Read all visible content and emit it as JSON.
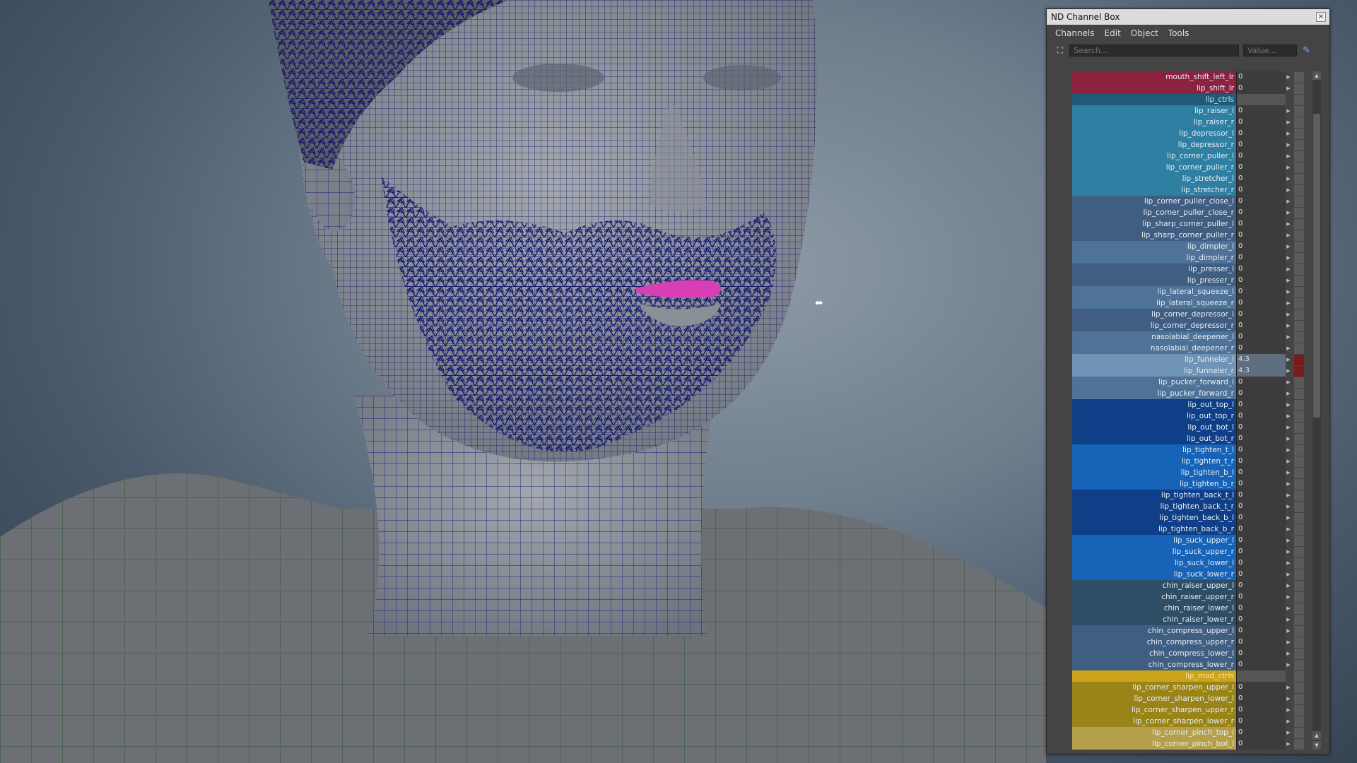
{
  "window": {
    "title": "ND Channel Box",
    "close_glyph": "×"
  },
  "menu": [
    "Channels",
    "Edit",
    "Object",
    "Tools"
  ],
  "search": {
    "placeholder": "Search...",
    "value_placeholder": "Value..."
  },
  "icons": {
    "select": "select-icon",
    "pencil": "pencil-icon",
    "scroll_up": "▲",
    "scroll_down": "▼"
  },
  "colors": {
    "crimson": "#8a2240",
    "teal_header": "#1f5a78",
    "teal": "#2f7fa3",
    "slate": "#3f5e82",
    "steel": "#4e7298",
    "funnel": "#6f94b6",
    "navy": "#0f3f86",
    "blue": "#1663b7",
    "dark_slate": "#2e4e66",
    "gold_header": "#caa41a",
    "olive": "#9a8418",
    "khaki": "#b4a04a"
  },
  "channels": [
    {
      "name": "mouth_shift_left_lr",
      "value": "0",
      "group": "crimson"
    },
    {
      "name": "lip_shift_lr",
      "value": "0",
      "group": "crimson"
    },
    {
      "name": "lip_ctrls",
      "value": "",
      "group": "teal_header",
      "header": true
    },
    {
      "name": "lip_raiser_l",
      "value": "0",
      "group": "teal"
    },
    {
      "name": "lip_raiser_r",
      "value": "0",
      "group": "teal"
    },
    {
      "name": "lip_depressor_l",
      "value": "0",
      "group": "teal"
    },
    {
      "name": "lip_depressor_r",
      "value": "0",
      "group": "teal"
    },
    {
      "name": "lip_corner_puller_l",
      "value": "0",
      "group": "teal"
    },
    {
      "name": "lip_corner_puller_r",
      "value": "0",
      "group": "teal"
    },
    {
      "name": "lip_stretcher_l",
      "value": "0",
      "group": "teal"
    },
    {
      "name": "lip_stretcher_r",
      "value": "0",
      "group": "teal"
    },
    {
      "name": "lip_corner_puller_close_l",
      "value": "0",
      "group": "slate"
    },
    {
      "name": "lip_corner_puller_close_r",
      "value": "0",
      "group": "slate"
    },
    {
      "name": "lip_sharp_corner_puller_l",
      "value": "0",
      "group": "slate"
    },
    {
      "name": "lip_sharp_corner_puller_r",
      "value": "0",
      "group": "slate"
    },
    {
      "name": "lip_dimpler_l",
      "value": "0",
      "group": "steel"
    },
    {
      "name": "lip_dimpler_r",
      "value": "0",
      "group": "steel"
    },
    {
      "name": "lip_presser_l",
      "value": "0",
      "group": "slate"
    },
    {
      "name": "lip_presser_r",
      "value": "0",
      "group": "slate"
    },
    {
      "name": "lip_lateral_squeeze_l",
      "value": "0",
      "group": "steel"
    },
    {
      "name": "lip_lateral_squeeze_r",
      "value": "0",
      "group": "steel"
    },
    {
      "name": "lip_corner_depressor_l",
      "value": "0",
      "group": "slate"
    },
    {
      "name": "lip_corner_depressor_r",
      "value": "0",
      "group": "slate"
    },
    {
      "name": "nasolabial_deepener_l",
      "value": "0",
      "group": "steel"
    },
    {
      "name": "nasolabial_deepener_r",
      "value": "0",
      "group": "steel"
    },
    {
      "name": "lip_funneler_l",
      "value": "4.3",
      "group": "funnel",
      "keyed": true
    },
    {
      "name": "lip_funneler_r",
      "value": "4.3",
      "group": "funnel",
      "keyed": true
    },
    {
      "name": "lip_pucker_forward_l",
      "value": "0",
      "group": "steel"
    },
    {
      "name": "lip_pucker_forward_r",
      "value": "0",
      "group": "steel"
    },
    {
      "name": "lip_out_top_l",
      "value": "0",
      "group": "navy"
    },
    {
      "name": "lip_out_top_r",
      "value": "0",
      "group": "navy"
    },
    {
      "name": "lip_out_bot_l",
      "value": "0",
      "group": "navy"
    },
    {
      "name": "lip_out_bot_r",
      "value": "0",
      "group": "navy"
    },
    {
      "name": "lip_tighten_t_l",
      "value": "0",
      "group": "blue"
    },
    {
      "name": "lip_tighten_t_r",
      "value": "0",
      "group": "blue"
    },
    {
      "name": "lip_tighten_b_l",
      "value": "0",
      "group": "blue"
    },
    {
      "name": "lip_tighten_b_r",
      "value": "0",
      "group": "blue"
    },
    {
      "name": "lip_tighten_back_t_l",
      "value": "0",
      "group": "navy"
    },
    {
      "name": "lip_tighten_back_t_r",
      "value": "0",
      "group": "navy"
    },
    {
      "name": "lip_tighten_back_b_l",
      "value": "0",
      "group": "navy"
    },
    {
      "name": "lip_tighten_back_b_r",
      "value": "0",
      "group": "navy"
    },
    {
      "name": "lip_suck_upper_l",
      "value": "0",
      "group": "blue"
    },
    {
      "name": "lip_suck_upper_r",
      "value": "0",
      "group": "blue"
    },
    {
      "name": "lip_suck_lower_l",
      "value": "0",
      "group": "blue"
    },
    {
      "name": "lip_suck_lower_r",
      "value": "0",
      "group": "blue"
    },
    {
      "name": "chin_raiser_upper_l",
      "value": "0",
      "group": "dark_slate"
    },
    {
      "name": "chin_raiser_upper_r",
      "value": "0",
      "group": "dark_slate"
    },
    {
      "name": "chin_raiser_lower_l",
      "value": "0",
      "group": "dark_slate"
    },
    {
      "name": "chin_raiser_lower_r",
      "value": "0",
      "group": "dark_slate"
    },
    {
      "name": "chin_compress_upper_l",
      "value": "0",
      "group": "slate"
    },
    {
      "name": "chin_compress_upper_r",
      "value": "0",
      "group": "slate"
    },
    {
      "name": "chin_compress_lower_l",
      "value": "0",
      "group": "slate"
    },
    {
      "name": "chin_compress_lower_r",
      "value": "0",
      "group": "slate"
    },
    {
      "name": "lip_mod_ctrls",
      "value": "",
      "group": "gold_header",
      "header": true
    },
    {
      "name": "lip_corner_sharpen_upper_l",
      "value": "0",
      "group": "olive"
    },
    {
      "name": "lip_corner_sharpen_lower_l",
      "value": "0",
      "group": "olive"
    },
    {
      "name": "lip_corner_sharpen_upper_r",
      "value": "0",
      "group": "olive"
    },
    {
      "name": "lip_corner_sharpen_lower_r",
      "value": "0",
      "group": "olive"
    },
    {
      "name": "lip_corner_pinch_top_l",
      "value": "0",
      "group": "khaki"
    },
    {
      "name": "lip_corner_pinch_bot_l",
      "value": "0",
      "group": "khaki"
    }
  ]
}
